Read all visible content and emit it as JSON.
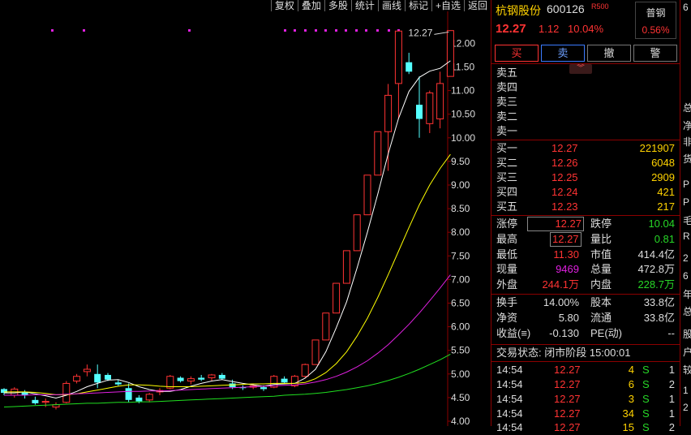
{
  "toolbar": [
    "复权",
    "叠加",
    "多股",
    "统计",
    "画线",
    "标记",
    "+自选",
    "返回"
  ],
  "chart_data": {
    "type": "candlestick",
    "ylim": [
      4.0,
      12.5
    ],
    "yticks": [
      4.0,
      4.5,
      5.0,
      5.5,
      6.0,
      6.5,
      7.0,
      7.5,
      8.0,
      8.5,
      9.0,
      9.5,
      10.0,
      10.5,
      11.0,
      11.5,
      12.0
    ],
    "annotation": "12.27",
    "candles": [
      [
        4.68,
        4.7,
        4.55,
        4.6
      ],
      [
        4.55,
        4.72,
        4.5,
        4.68
      ],
      [
        4.62,
        4.66,
        4.48,
        4.55
      ],
      [
        4.45,
        4.52,
        4.35,
        4.38
      ],
      [
        4.4,
        4.48,
        4.3,
        4.42
      ],
      [
        4.3,
        4.4,
        4.25,
        4.35
      ],
      [
        4.4,
        4.85,
        4.38,
        4.8
      ],
      [
        4.85,
        5.0,
        4.8,
        4.95
      ],
      [
        5.05,
        5.2,
        4.95,
        5.1
      ],
      [
        5.0,
        5.2,
        4.7,
        4.82
      ],
      [
        4.98,
        5.02,
        4.85,
        4.88
      ],
      [
        4.82,
        4.88,
        4.75,
        4.78
      ],
      [
        4.7,
        4.8,
        4.4,
        4.45
      ],
      [
        4.5,
        4.55,
        4.38,
        4.42
      ],
      [
        4.45,
        4.6,
        4.4,
        4.57
      ],
      [
        4.62,
        4.7,
        4.55,
        4.65
      ],
      [
        4.7,
        4.98,
        4.68,
        4.95
      ],
      [
        4.92,
        4.95,
        4.82,
        4.85
      ],
      [
        4.85,
        4.95,
        4.78,
        4.9
      ],
      [
        4.92,
        4.98,
        4.85,
        4.88
      ],
      [
        4.92,
        5.0,
        4.86,
        4.98
      ],
      [
        4.98,
        5.02,
        4.88,
        4.9
      ],
      [
        4.8,
        4.88,
        4.68,
        4.72
      ],
      [
        4.72,
        4.76,
        4.66,
        4.7
      ],
      [
        4.72,
        4.78,
        4.68,
        4.75
      ],
      [
        4.72,
        4.76,
        4.64,
        4.68
      ],
      [
        4.72,
        4.98,
        4.7,
        4.95
      ],
      [
        4.9,
        4.95,
        4.8,
        4.82
      ],
      [
        4.75,
        4.98,
        4.72,
        4.95
      ],
      [
        4.95,
        5.22,
        4.92,
        5.2
      ],
      [
        5.2,
        5.72,
        5.2,
        5.72
      ],
      [
        5.72,
        6.29,
        5.72,
        6.29
      ],
      [
        6.29,
        6.92,
        6.29,
        6.92
      ],
      [
        6.92,
        7.61,
        6.92,
        7.61
      ],
      [
        7.61,
        8.37,
        7.61,
        8.37
      ],
      [
        8.37,
        9.21,
        8.37,
        9.21
      ],
      [
        9.21,
        10.13,
        9.21,
        10.13
      ],
      [
        10.13,
        11.14,
        9.3,
        10.9
      ],
      [
        11.15,
        12.26,
        10.4,
        12.26
      ],
      [
        11.6,
        11.8,
        11.35,
        11.4
      ],
      [
        10.7,
        11.3,
        10.0,
        10.4
      ],
      [
        10.3,
        11.0,
        10.1,
        10.95
      ],
      [
        10.4,
        11.4,
        10.2,
        11.15
      ],
      [
        11.3,
        12.27,
        11.3,
        12.27
      ]
    ],
    "ma": [
      {
        "color": "#ffffff",
        "values": [
          4.6,
          4.6,
          4.62,
          4.58,
          4.54,
          4.49,
          4.55,
          4.63,
          4.73,
          4.8,
          4.87,
          4.88,
          4.82,
          4.73,
          4.67,
          4.63,
          4.63,
          4.67,
          4.74,
          4.8,
          4.85,
          4.88,
          4.84,
          4.8,
          4.77,
          4.74,
          4.78,
          4.79,
          4.8,
          4.91,
          5.1,
          5.47,
          5.98,
          6.53,
          7.24,
          8.0,
          8.81,
          9.66,
          10.41,
          10.98,
          11.28,
          11.41,
          11.47,
          11.63
        ]
      },
      {
        "color": "#ffff00",
        "values": [
          4.62,
          4.62,
          4.62,
          4.61,
          4.59,
          4.56,
          4.56,
          4.58,
          4.62,
          4.66,
          4.7,
          4.74,
          4.77,
          4.77,
          4.76,
          4.74,
          4.73,
          4.73,
          4.73,
          4.74,
          4.75,
          4.76,
          4.77,
          4.78,
          4.79,
          4.79,
          4.8,
          4.8,
          4.8,
          4.82,
          4.9,
          5.03,
          5.22,
          5.47,
          5.8,
          6.18,
          6.62,
          7.1,
          7.6,
          8.1,
          8.58,
          9.0,
          9.35,
          9.65,
          10.35
        ]
      },
      {
        "color": "#e020e0",
        "values": [
          4.55,
          4.55,
          4.55,
          4.56,
          4.56,
          4.56,
          4.57,
          4.58,
          4.59,
          4.6,
          4.61,
          4.62,
          4.63,
          4.63,
          4.64,
          4.64,
          4.65,
          4.66,
          4.67,
          4.68,
          4.69,
          4.7,
          4.71,
          4.72,
          4.73,
          4.74,
          4.75,
          4.76,
          4.77,
          4.79,
          4.83,
          4.88,
          4.95,
          5.04,
          5.15,
          5.28,
          5.44,
          5.62,
          5.83,
          6.05,
          6.29,
          6.55,
          6.82,
          7.1,
          7.82
        ]
      },
      {
        "color": "#20e020",
        "values": [
          4.3,
          4.31,
          4.32,
          4.33,
          4.34,
          4.35,
          4.36,
          4.37,
          4.38,
          4.38,
          4.39,
          4.4,
          4.4,
          4.41,
          4.41,
          4.42,
          4.43,
          4.44,
          4.45,
          4.46,
          4.47,
          4.48,
          4.49,
          4.5,
          4.51,
          4.52,
          4.53,
          4.55,
          4.56,
          4.57,
          4.59,
          4.61,
          4.64,
          4.67,
          4.71,
          4.75,
          4.8,
          4.86,
          4.93,
          5.01,
          5.1,
          5.2,
          5.3,
          5.42,
          5.58
        ]
      }
    ],
    "top_dots_color": "#e020e0"
  },
  "quote": {
    "name": "杭钢股份",
    "code": "600126",
    "rtag": "R500",
    "tag_title": "普钢",
    "tag_pct": "0.56%",
    "price": "12.27",
    "change": "1.12",
    "change_pct": "10.04%"
  },
  "buttons": [
    "买",
    "卖",
    "撤",
    "警"
  ],
  "expand_icon": "double-chevron-down",
  "sells": [
    {
      "label": "卖五",
      "price": "",
      "vol": ""
    },
    {
      "label": "卖四",
      "price": "",
      "vol": ""
    },
    {
      "label": "卖三",
      "price": "",
      "vol": ""
    },
    {
      "label": "卖二",
      "price": "",
      "vol": ""
    },
    {
      "label": "卖一",
      "price": "",
      "vol": ""
    }
  ],
  "buys": [
    {
      "label": "买一",
      "price": "12.27",
      "vol": "221907"
    },
    {
      "label": "买二",
      "price": "12.26",
      "vol": "6048"
    },
    {
      "label": "买三",
      "price": "12.25",
      "vol": "2909"
    },
    {
      "label": "买四",
      "price": "12.24",
      "vol": "421"
    },
    {
      "label": "买五",
      "price": "12.23",
      "vol": "217"
    }
  ],
  "stats": {
    "limit_up_label": "涨停",
    "limit_up": "12.27",
    "limit_down_label": "跌停",
    "limit_down": "10.04",
    "high_label": "最高",
    "high": "12.27",
    "vol_ratio_label": "量比",
    "vol_ratio": "0.81",
    "low_label": "最低",
    "low": "11.30",
    "mktcap_label": "市值",
    "mktcap": "414.4亿",
    "cur_label": "现量",
    "cur": "9469",
    "total_label": "总量",
    "total": "472.8万",
    "outer_label": "外盘",
    "outer": "244.1万",
    "inner_label": "内盘",
    "inner": "228.7万",
    "turnover_label": "换手",
    "turnover": "14.00%",
    "capital_label": "股本",
    "capital": "33.8亿",
    "nav_label": "净资",
    "nav": "5.80",
    "float_label": "流通",
    "float": "33.8亿",
    "eps_label": "收益(≡)",
    "eps": "-0.130",
    "pe_label": "PE(动)",
    "pe": "--"
  },
  "trade_status": "交易状态: 闭市阶段 15:00:01",
  "ticks": [
    {
      "time": "14:54",
      "price": "12.27",
      "vol": "4",
      "side": "S",
      "n": "1"
    },
    {
      "time": "14:54",
      "price": "12.27",
      "vol": "6",
      "side": "S",
      "n": "2"
    },
    {
      "time": "14:54",
      "price": "12.27",
      "vol": "3",
      "side": "S",
      "n": "1"
    },
    {
      "time": "14:54",
      "price": "12.27",
      "vol": "34",
      "side": "S",
      "n": "1"
    },
    {
      "time": "14:54",
      "price": "12.27",
      "vol": "15",
      "side": "S",
      "n": "2"
    }
  ],
  "edge_text": [
    "6",
    "总",
    "净",
    "非",
    "货",
    "P",
    "P",
    "毛",
    "R",
    "2",
    "6",
    "年",
    "总",
    "股",
    "户",
    "较",
    "1",
    "2"
  ]
}
